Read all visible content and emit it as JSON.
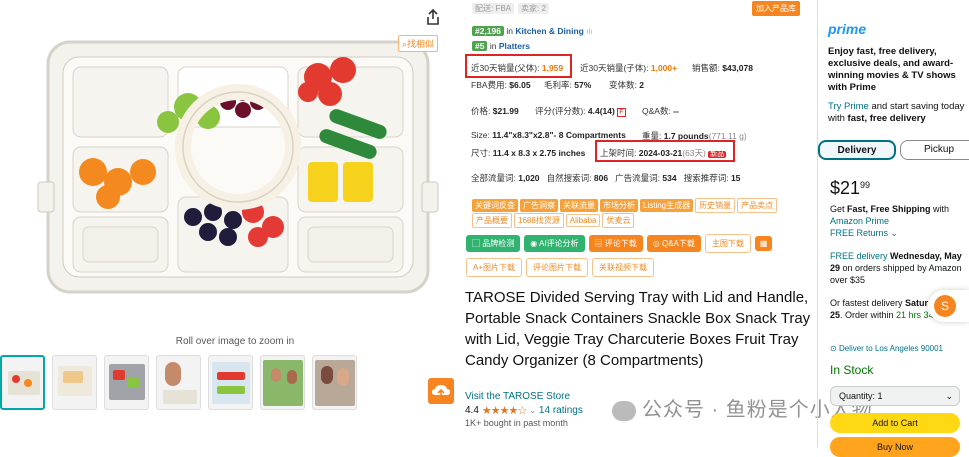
{
  "gallery": {
    "zoom_hint": "Roll over image to zoom in",
    "find_similar": "找相似",
    "thumbnails": 7
  },
  "ext": {
    "seller_tags": [
      "配送: FBA",
      "卖家: 2"
    ],
    "add_library": "加入产品库",
    "rank1": {
      "num": "#2,196",
      "pre": "in",
      "cat": "Kitchen & Dining"
    },
    "rank2": {
      "num": "#5",
      "pre": "in",
      "cat": "Platters"
    },
    "sales30_parent_label": "近30天销量(父体):",
    "sales30_parent": "1,959",
    "sales30_child_label": "近30天销量(子体):",
    "sales30_child": "1,000+",
    "revenue_label": "销售额:",
    "revenue": "$43,078",
    "fba_label": "FBA费用:",
    "fba": "$6.05",
    "margin_label": "毛利率:",
    "margin": "57%",
    "variants_label": "变体数:",
    "variants": "2",
    "price_label": "价格:",
    "price": "$21.99",
    "rating_label": "评分(评分数):",
    "rating": "4.4(14)",
    "qa_label": "Q&A数:",
    "qa": "--",
    "size_label": "Size:",
    "size": "11.4\"x8.3\"x2.8\"- 8 Compartments",
    "weight_label": "重量:",
    "weight": "1.7 pounds",
    "weight_g": "(771.11 g)",
    "dims_label": "尺寸:",
    "dims": "11.4 x 8.3 x 2.75 inches",
    "listed_label": "上架时间:",
    "listed": "2024-03-21",
    "listed_days": "(63天)",
    "new_badge": "新品",
    "search_label": "全部流量词:",
    "search": "1,020",
    "organic_label": "自然搜索词:",
    "organic": "806",
    "ad_label": "广告流量词:",
    "ad": "534",
    "rec_label": "搜索推荐词:",
    "rec": "15",
    "tags_row1": [
      "关键词反查",
      "广告洞察",
      "关联流量",
      "市场分析",
      "Listing生成器"
    ],
    "tags_row1_outline": [
      "历史销量",
      "产品卖点"
    ],
    "tags_row2": [
      "产品概要",
      "1688找货源",
      "Alibaba",
      "优麦云"
    ],
    "tool_buttons": [
      "品牌检测",
      "AI评论分析",
      "评论下载",
      "Q&A下载"
    ],
    "tool_outline": "主图下载",
    "tool_row2": [
      "A+图片下载",
      "评论图片下载",
      "关联视频下载"
    ]
  },
  "product": {
    "title": "TAROSE Divided Serving Tray with Lid and Handle, Portable Snack Containers Snackle Box Snack Tray with Lid, Veggie Tray Charcuterie Boxes Fruit Tray Candy Organizer (8 Compartments)",
    "store": "Visit the TAROSE Store",
    "rating_value": "4.4",
    "stars": "★★★★☆",
    "rating_count": "14 ratings",
    "bought": "1K+ bought in past month"
  },
  "watermark": "公众号 · 鱼粉是个小人物",
  "buybox": {
    "prime_logo": "prime",
    "prime_line1": "Enjoy fast, free delivery, exclusive deals, and award-winning movies & TV shows with Prime",
    "try_prime": "Try Prime",
    "prime_line2": " and start saving today with ",
    "prime_line2b": "fast, free delivery",
    "tab_delivery": "Delivery",
    "tab_pickup": "Pickup",
    "price_dollars": "$21",
    "price_cents": "99",
    "free_ship1": "Get ",
    "free_ship_b": "Fast, Free Shipping",
    "free_ship2": " with",
    "amazon_prime": "Amazon Prime",
    "free_returns": "FREE Returns",
    "free_delivery": "FREE delivery ",
    "delivery_date": "Wednesday, May 29",
    "delivery_rest": " on orders shipped by Amazon over $35",
    "fastest": "Or fastest delivery ",
    "fastest_b": "Saturday, May 25",
    "fastest_rest": ". Order within ",
    "fastest_time": "21 hrs 34 mins",
    "deliver_to": "Deliver to Los Angeles 90001",
    "in_stock": "In Stock",
    "quantity": "Quantity: 1",
    "add_to_cart": "Add to Cart",
    "buy_now": "Buy Now"
  }
}
